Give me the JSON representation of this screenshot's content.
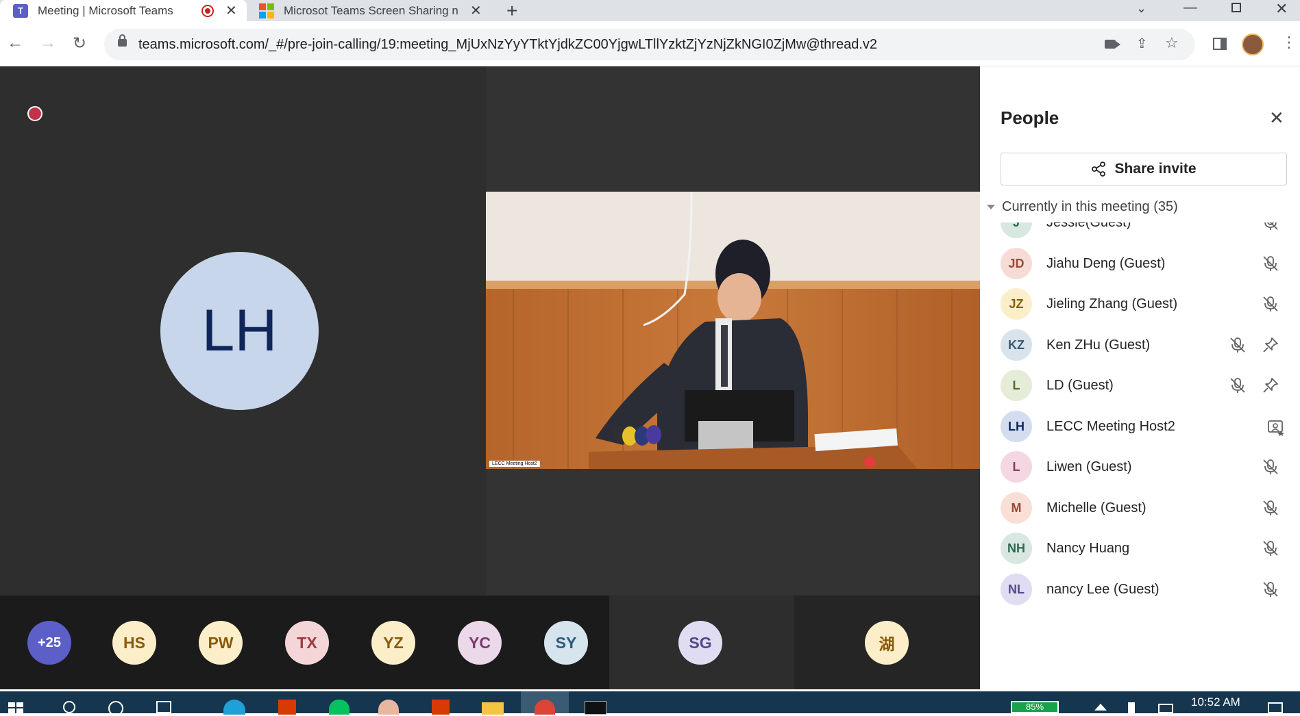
{
  "browser": {
    "tabs": [
      {
        "title": "Meeting | Microsoft Teams",
        "active": true
      },
      {
        "title": "Microsot Teams Screen Sharing n",
        "active": false
      }
    ],
    "url": "teams.microsoft.com/_#/pre-join-calling/19:meeting_MjUxNzYyYTktYjdkZC00YjgwLTllYzktZjYzNjZkNGI0ZjMw@thread.v2",
    "new_tab_glyph": "+"
  },
  "stage": {
    "recording_indicator": "recording-icon",
    "main_participant_initials": "LH",
    "video_label": "LECC Meeting Host2",
    "strip": [
      {
        "initials": "+25",
        "bg": "#5b5fc7",
        "fg": "#ffffff"
      },
      {
        "initials": "HS",
        "bg": "#fbeec8",
        "fg": "#8a5a0b"
      },
      {
        "initials": "PW",
        "bg": "#fbeec8",
        "fg": "#8a5a0b"
      },
      {
        "initials": "TX",
        "bg": "#f5d6d8",
        "fg": "#9a3a3f"
      },
      {
        "initials": "YZ",
        "bg": "#fbeec8",
        "fg": "#8a5a0b"
      },
      {
        "initials": "YC",
        "bg": "#ebd8e8",
        "fg": "#7a3b70"
      },
      {
        "initials": "SY",
        "bg": "#d6e4ee",
        "fg": "#2a5b7b"
      },
      {
        "initials": "SG",
        "bg": "#e0dcf2",
        "fg": "#4f4a8a"
      },
      {
        "initials": "湖",
        "bg": "#fbeec8",
        "fg": "#8a5a0b"
      }
    ]
  },
  "people": {
    "title": "People",
    "share_invite": "Share invite",
    "section": "Currently in this meeting (35)",
    "rows": [
      {
        "initials": "J",
        "name": "Jessie(Guest)",
        "bg": "#d8e8e1",
        "fg": "#2b6b50",
        "icons": [
          "mic-off"
        ]
      },
      {
        "initials": "JD",
        "name": "Jiahu Deng (Guest)",
        "bg": "#f7dcd6",
        "fg": "#9a4a36",
        "icons": [
          "mic-off"
        ]
      },
      {
        "initials": "JZ",
        "name": "Jieling Zhang (Guest)",
        "bg": "#fbeec8",
        "fg": "#8a5a0b",
        "icons": [
          "mic-off"
        ]
      },
      {
        "initials": "KZ",
        "name": "Ken ZHu (Guest)",
        "bg": "#d9e3ec",
        "fg": "#3b5a74",
        "icons": [
          "mic-off",
          "pin"
        ]
      },
      {
        "initials": "L",
        "name": "LD (Guest)",
        "bg": "#e5ecd8",
        "fg": "#4e6b2a",
        "icons": [
          "mic-off",
          "pin"
        ]
      },
      {
        "initials": "LH",
        "name": "LECC Meeting Host2",
        "bg": "#d3ddef",
        "fg": "#10265a",
        "icons": [
          "presenter"
        ]
      },
      {
        "initials": "L",
        "name": "Liwen (Guest)",
        "bg": "#f5d6e3",
        "fg": "#8a3a5e",
        "icons": [
          "mic-off"
        ]
      },
      {
        "initials": "M",
        "name": "Michelle (Guest)",
        "bg": "#fadfd6",
        "fg": "#9a4a36",
        "icons": [
          "mic-off"
        ]
      },
      {
        "initials": "NH",
        "name": "Nancy Huang",
        "bg": "#d8e8e1",
        "fg": "#2b6b50",
        "icons": [
          "mic-off"
        ]
      },
      {
        "initials": "NL",
        "name": "nancy Lee (Guest)",
        "bg": "#e0dcf2",
        "fg": "#4f4a8a",
        "icons": [
          "mic-off"
        ]
      }
    ]
  },
  "taskbar": {
    "battery": "85%",
    "time": "10:52 AM"
  }
}
